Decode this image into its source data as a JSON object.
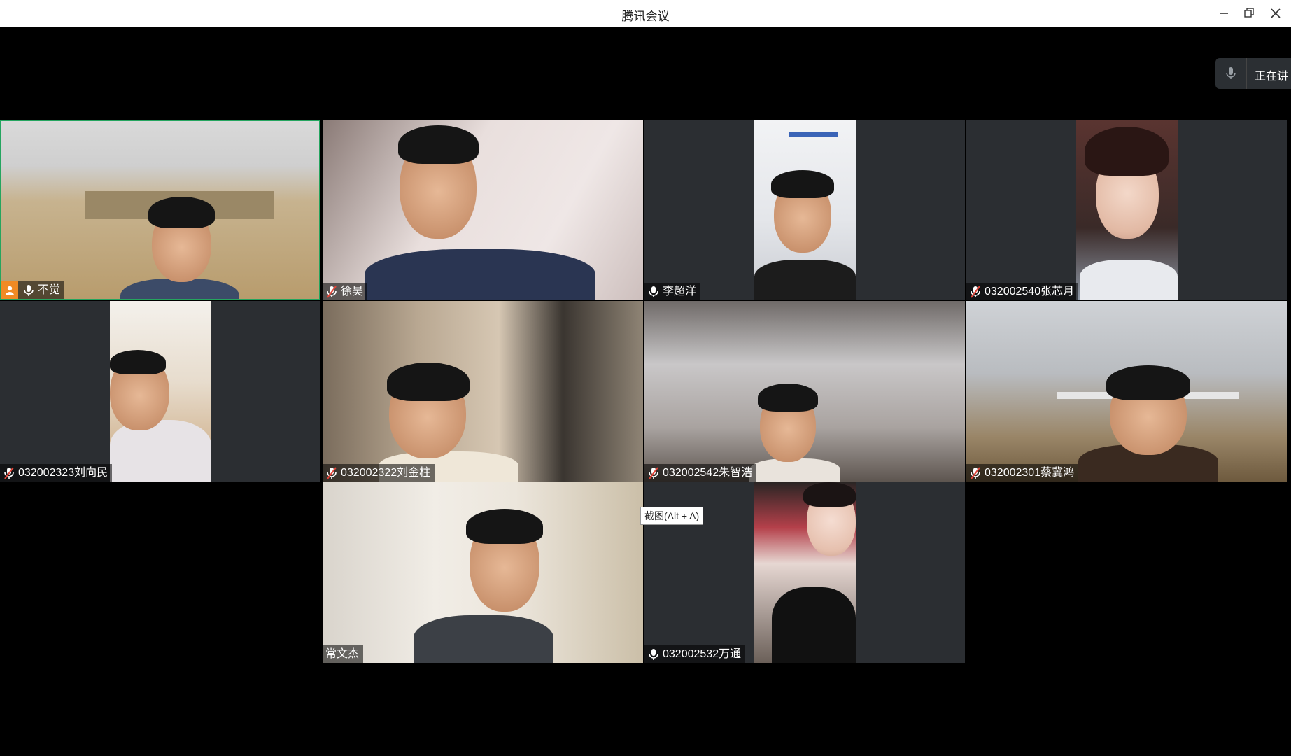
{
  "window": {
    "title": "腾讯会议"
  },
  "speaking": {
    "label": "正在讲"
  },
  "tooltip": {
    "text": "截图(Alt + A)"
  },
  "participants": [
    {
      "name": "不觉",
      "mic": "on",
      "host": true
    },
    {
      "name": "徐昊",
      "mic": "muted"
    },
    {
      "name": "李超洋",
      "mic": "on"
    },
    {
      "name": "032002540张芯月",
      "mic": "muted"
    },
    {
      "name": "032002323刘向民",
      "mic": "muted"
    },
    {
      "name": "032002322刘金柱",
      "mic": "muted"
    },
    {
      "name": "032002542朱智浩",
      "mic": "muted"
    },
    {
      "name": "032002301蔡冀鸿",
      "mic": "muted"
    },
    {
      "name": "常文杰",
      "mic": "none"
    },
    {
      "name": "032002532万通",
      "mic": "on"
    }
  ],
  "colors": {
    "active_border": "#25a55f",
    "host_badge": "#f08a24",
    "tile_bg": "#2b2e32",
    "muted_slash": "#e0453a"
  },
  "icons": {
    "mic": "microphone-icon",
    "muted": "microphone-muted-icon",
    "host": "host-user-icon"
  }
}
